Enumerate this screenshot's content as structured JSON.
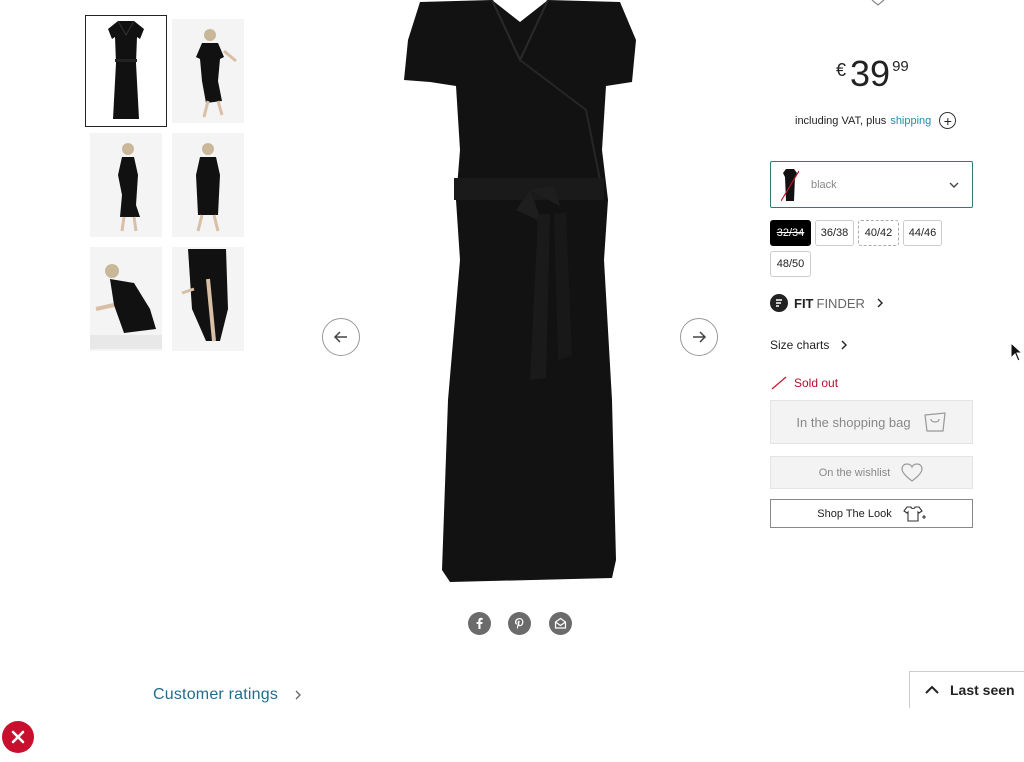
{
  "product": {
    "price": {
      "currency": "€",
      "integer": "39",
      "decimals": "99"
    },
    "vat": {
      "prefix": "including VAT, plus",
      "link": "shipping",
      "info_icon": "plus-circle-icon"
    },
    "color": {
      "label": "black",
      "swatch_hex": "#111111",
      "available": false
    },
    "sizes": [
      {
        "label": "32/34",
        "selected": true,
        "style": "solid"
      },
      {
        "label": "36/38",
        "selected": false,
        "style": "solid"
      },
      {
        "label": "40/42",
        "selected": false,
        "style": "dashed"
      },
      {
        "label": "44/46",
        "selected": false,
        "style": "solid"
      },
      {
        "label": "48/50",
        "selected": false,
        "style": "solid"
      }
    ],
    "fit_finder": {
      "brand_bold": "FIT",
      "brand_light": "FINDER"
    },
    "size_charts": "Size charts",
    "availability": "Sold out",
    "buttons": {
      "bag": "In the shopping bag",
      "wishlist": "On the wishlist",
      "shop_look": "Shop The Look"
    }
  },
  "gallery": {
    "thumbnail_count": 6,
    "share_icons": [
      "facebook-icon",
      "pinterest-icon",
      "email-icon"
    ]
  },
  "footer": {
    "ratings_label": "Customer ratings",
    "last_seen_label": "Last seen"
  },
  "colors": {
    "accent": "#1f8bb0",
    "select_border": "#2f7b74",
    "sold_out": "#b0102c",
    "close_button": "#c8102e",
    "dress": "#111111"
  }
}
